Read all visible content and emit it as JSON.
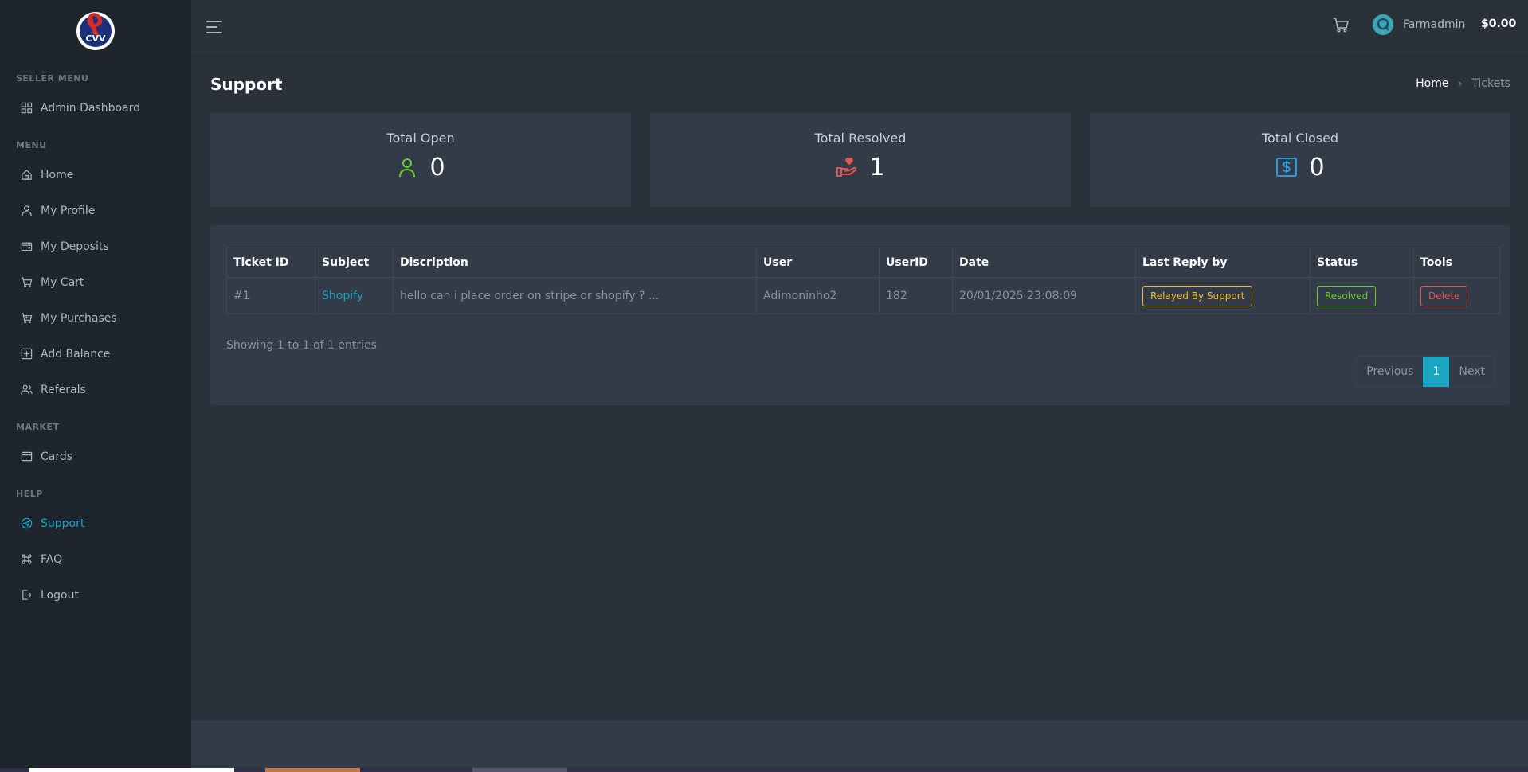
{
  "sidebar": {
    "logo_text": "CVV",
    "sections": {
      "seller": "SELLER MENU",
      "menu": "MENU",
      "market": "MARKET",
      "help": "HELP"
    },
    "items": {
      "admin_dashboard": "Admin Dashboard",
      "home": "Home",
      "my_profile": "My Profile",
      "my_deposits": "My Deposits",
      "my_cart": "My Cart",
      "my_purchases": "My Purchases",
      "add_balance": "Add Balance",
      "referals": "Referals",
      "cards": "Cards",
      "support": "Support",
      "faq": "FAQ",
      "logout": "Logout"
    },
    "active_item": "support"
  },
  "topbar": {
    "username": "Farmadmin",
    "balance": "$0.00"
  },
  "page": {
    "title": "Support",
    "breadcrumb": {
      "home": "Home",
      "separator": "›",
      "current": "Tickets"
    }
  },
  "stats": {
    "open": {
      "label": "Total Open",
      "value": "0",
      "icon": "user-icon",
      "color": "#6bcb2c"
    },
    "resolved": {
      "label": "Total Resolved",
      "value": "1",
      "icon": "heart-hand-icon",
      "color": "#e55353"
    },
    "closed": {
      "label": "Total Closed",
      "value": "0",
      "icon": "dollar-bill-icon",
      "color": "#2d9cdb"
    }
  },
  "table": {
    "headers": {
      "ticket_id": "Ticket ID",
      "subject": "Subject",
      "description": "Discription",
      "user": "User",
      "userid": "UserID",
      "date": "Date",
      "last_reply": "Last Reply by",
      "status": "Status",
      "tools": "Tools"
    },
    "rows": [
      {
        "ticket_id": "#1",
        "subject": "Shopify",
        "description": "hello can i place order on stripe or shopify ? ...",
        "user": "Adimoninho2",
        "userid": "182",
        "date": "20/01/2025 23:08:09",
        "last_reply": "Relayed By Support",
        "status": "Resolved",
        "tool": "Delete"
      }
    ],
    "entries_text": "Showing 1 to 1 of 1 entries",
    "pagination": {
      "previous": "Previous",
      "current": "1",
      "next": "Next"
    }
  },
  "colors": {
    "accent": "#1aa6c3",
    "warning": "#f3b92c",
    "success": "#6bcb2c",
    "danger": "#e55353"
  }
}
